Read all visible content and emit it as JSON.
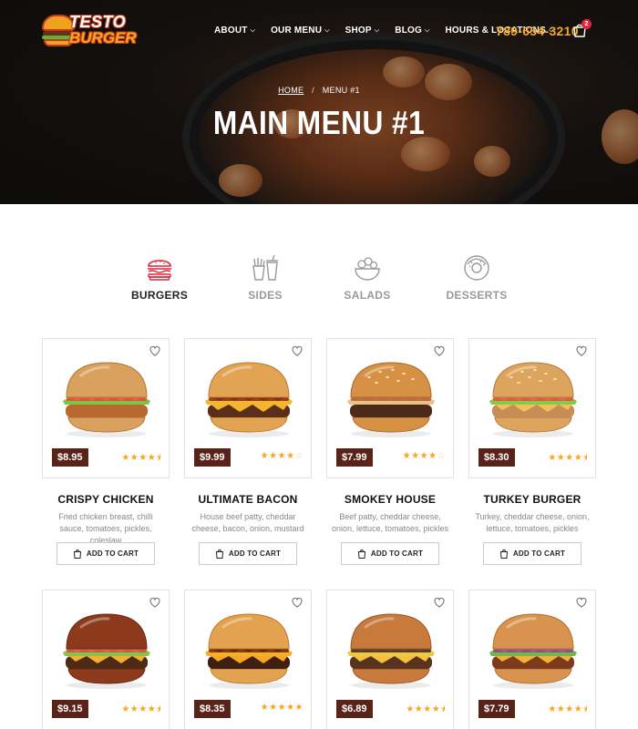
{
  "header": {
    "logo_line1": "TESTO",
    "logo_line2": "BURGER",
    "nav": [
      {
        "label": "ABOUT"
      },
      {
        "label": "OUR MENU"
      },
      {
        "label": "SHOP"
      },
      {
        "label": "BLOG"
      },
      {
        "label": "HOURS & LOCATIONS"
      }
    ],
    "phone": "789-654-3210",
    "cart_count": "2"
  },
  "hero": {
    "breadcrumb_home": "HOME",
    "breadcrumb_separator": "/",
    "breadcrumb_current": "MENU #1",
    "title": "MAIN MENU #1"
  },
  "categories": [
    {
      "label": "BURGERS",
      "icon": "burger-icon",
      "active": true
    },
    {
      "label": "SIDES",
      "icon": "fries-drink-icon",
      "active": false
    },
    {
      "label": "SALADS",
      "icon": "salad-bowl-icon",
      "active": false
    },
    {
      "label": "DESSERTS",
      "icon": "donut-icon",
      "active": false
    }
  ],
  "add_to_cart_label": "ADD TO CART",
  "products": [
    {
      "name": "CRISPY CHICKEN",
      "price": "$8.95",
      "rating": 4.5,
      "desc": "Fried chicken breast, chilli sauce, tomatoes, pickles, coleslaw"
    },
    {
      "name": "ULTIMATE BACON",
      "price": "$9.99",
      "rating": 4,
      "desc": "House beef patty, cheddar cheese, bacon, onion, mustard"
    },
    {
      "name": "SMOKEY HOUSE",
      "price": "$7.99",
      "rating": 4,
      "desc": "Beef patty, cheddar cheese, onion, lettuce, tomatoes, pickles"
    },
    {
      "name": "TURKEY BURGER",
      "price": "$8.30",
      "rating": 4.5,
      "desc": "Turkey, cheddar cheese, onion, lettuce, tomatoes, pickles"
    },
    {
      "name": "",
      "price": "$9.15",
      "rating": 4.5,
      "desc": ""
    },
    {
      "name": "",
      "price": "$8.35",
      "rating": 5,
      "desc": ""
    },
    {
      "name": "",
      "price": "$6.89",
      "rating": 4.5,
      "desc": ""
    },
    {
      "name": "",
      "price": "$7.79",
      "rating": 4.5,
      "desc": ""
    }
  ],
  "colors": {
    "accent": "#f5a623",
    "price_bg": "#5a2319",
    "active_icon": "#d7263d",
    "inactive_text": "#999999"
  }
}
